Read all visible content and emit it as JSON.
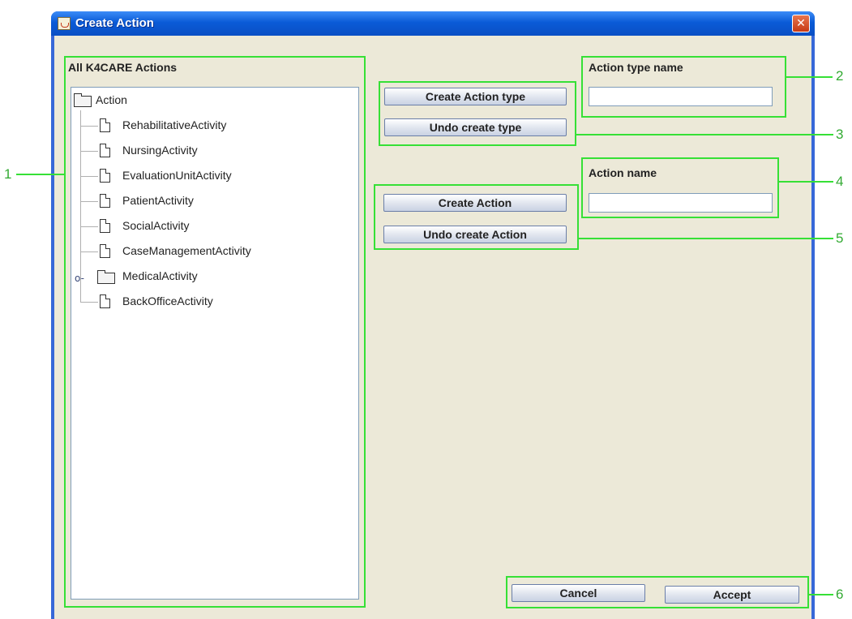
{
  "window": {
    "title": "Create Action"
  },
  "tree_panel": {
    "label": "All K4CARE Actions",
    "root": "Action",
    "items": [
      "RehabilitativeActivity",
      "NursingActivity",
      "EvaluationUnitActivity",
      "PatientActivity",
      "SocialActivity",
      "CaseManagementActivity",
      "MedicalActivity",
      "BackOfficeActivity"
    ]
  },
  "type_buttons": {
    "create": "Create Action type",
    "undo": "Undo create type"
  },
  "type_name": {
    "label": "Action type name",
    "value": ""
  },
  "action_buttons": {
    "create": "Create Action",
    "undo": "Undo create Action"
  },
  "action_name": {
    "label": "Action name",
    "value": ""
  },
  "dialog_buttons": {
    "cancel": "Cancel",
    "accept": "Accept"
  },
  "callouts": [
    "1",
    "2",
    "3",
    "4",
    "5",
    "6"
  ],
  "colors": {
    "highlight": "#36e036",
    "titlebar": "#0a5bd7",
    "panel": "#ece9d8"
  }
}
